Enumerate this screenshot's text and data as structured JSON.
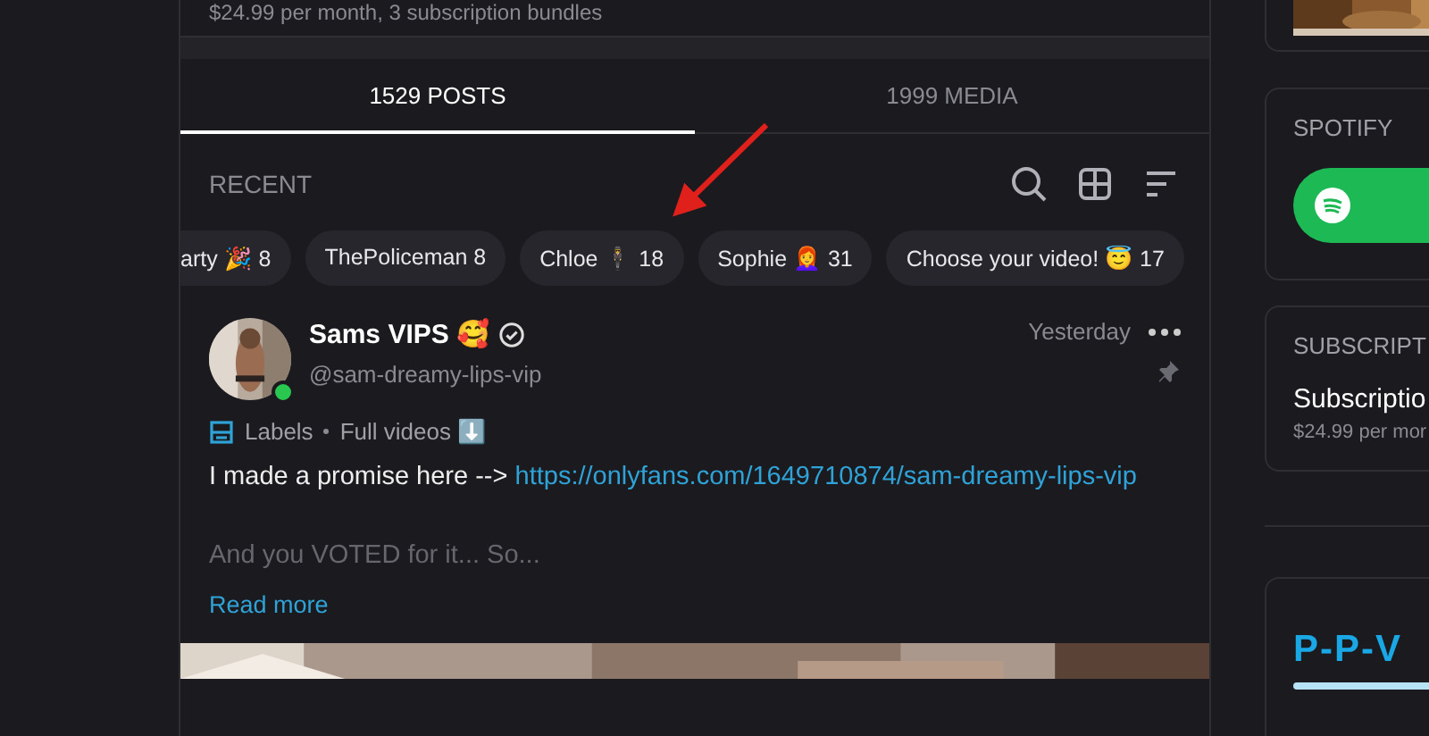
{
  "top_note": "$24.99 per month, 3 subscription bundles",
  "tabs": [
    {
      "label": "1529 POSTS",
      "selected": true
    },
    {
      "label": "1999 MEDIA",
      "selected": false
    }
  ],
  "section_title": "RECENT",
  "chips": [
    "arty 🎉 8",
    "ThePoliceman 8",
    "Chloe 🕴 18",
    "Sophie 👩‍🦰 31",
    "Choose your video! 😇 17"
  ],
  "post": {
    "author": "Sams VIPS 🥰",
    "verified": true,
    "online": true,
    "handle": "@sam-dreamy-lips-vip",
    "time": "Yesterday",
    "pinned": true,
    "labels_title": "Labels",
    "label": "Full videos ⬇️",
    "text": "I made a promise here --> ",
    "link": "https://onlyfans.com/1649710874/sam-dreamy-lips-vip",
    "faded_text": "And you VOTED for it... So...",
    "read_more": "Read more"
  },
  "sidebar": {
    "spotify_title": "SPOTIFY",
    "subscription_title": "SUBSCRIPT",
    "subscription_name": "Subscriptio",
    "subscription_price": "$24.99 per mor",
    "ppv_title": "P-P-V"
  }
}
